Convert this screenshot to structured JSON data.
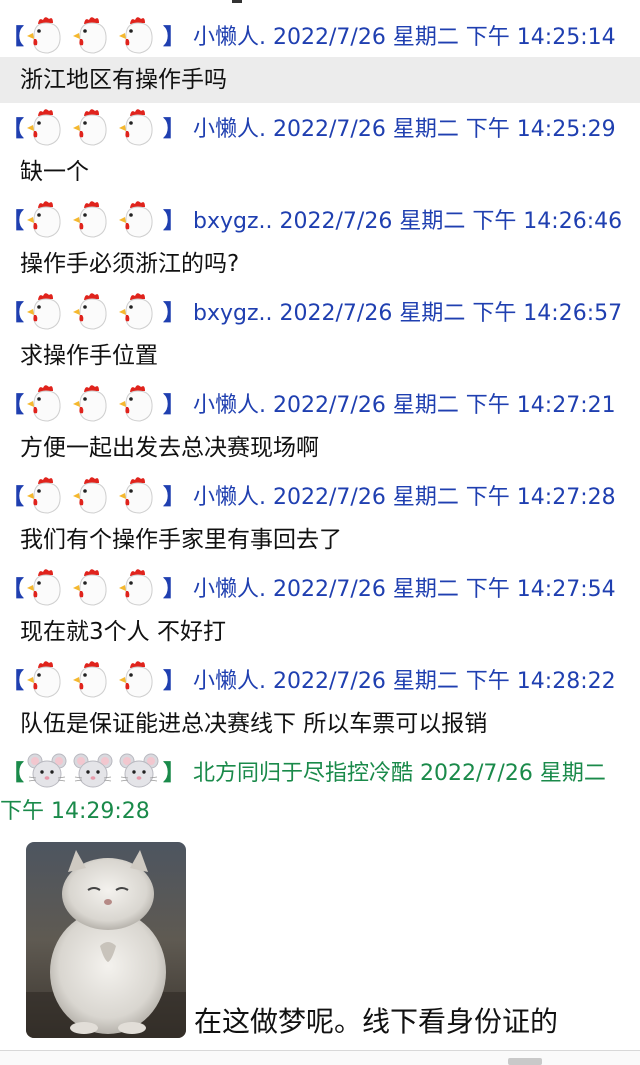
{
  "bracket_open": "【",
  "bracket_close": "】",
  "colors": {
    "blue_name": "#1f3fb0",
    "green_name": "#1a8a4a",
    "highlight": "#ececec"
  },
  "messages": [
    {
      "emoji": "rooster-icon",
      "header": "小懒人. 2022/7/26 星期二 下午 14:25:14",
      "text": "浙江地区有操作手吗",
      "highlight": true
    },
    {
      "emoji": "rooster-icon",
      "header": "小懒人. 2022/7/26 星期二 下午 14:25:29",
      "text": "缺一个"
    },
    {
      "emoji": "rooster-icon",
      "header": "bxygz.. 2022/7/26 星期二 下午 14:26:46",
      "text": "操作手必须浙江的吗?"
    },
    {
      "emoji": "rooster-icon",
      "header": "bxygz.. 2022/7/26 星期二 下午 14:26:57",
      "text": "求操作手位置"
    },
    {
      "emoji": "rooster-icon",
      "header": "小懒人. 2022/7/26 星期二 下午 14:27:21",
      "text": "方便一起出发去总决赛现场啊"
    },
    {
      "emoji": "rooster-icon",
      "header": "小懒人. 2022/7/26 星期二 下午 14:27:28",
      "text": "我们有个操作手家里有事回去了"
    },
    {
      "emoji": "rooster-icon",
      "header": "小懒人. 2022/7/26 星期二 下午 14:27:54",
      "text": "现在就3个人 不好打"
    },
    {
      "emoji": "rooster-icon",
      "header": "小懒人. 2022/7/26 星期二 下午 14:28:22",
      "text": "队伍是保证能进总决赛线下 所以车票可以报销"
    }
  ],
  "last_message": {
    "emoji": "mouse-icon",
    "header": "北方同归于尽指控冷酷 2022/7/26 星期二",
    "header_wrap": "下午 14:29:28",
    "image": "fluffy-cat-photo",
    "text": "在这做梦呢。线下看身份证的"
  }
}
